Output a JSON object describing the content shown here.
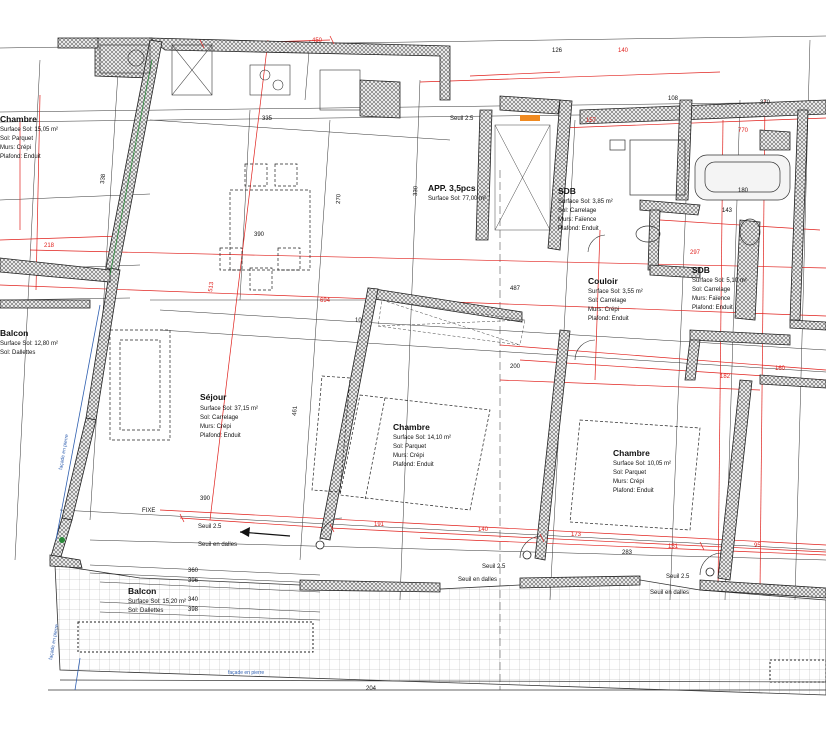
{
  "apartment": {
    "title": "APP. 3,5pcs",
    "surface": "Surface Sol: 77,00 m²"
  },
  "rooms": [
    {
      "id": "chambre-left",
      "title": "Chambre",
      "lines": [
        "Surface Sol: 15,05 m²",
        "Sol: Parquet",
        "Murs: Crépi",
        "Plafond: Enduit"
      ]
    },
    {
      "id": "balcon-left",
      "title": "Balcon",
      "lines": [
        "Surface Sol: 12,80 m²",
        "Sol: Dallettes"
      ]
    },
    {
      "id": "sejour",
      "title": "Séjour",
      "lines": [
        "Surface Sol: 37,15 m²",
        "Sol: Carrelage",
        "Murs: Crépi",
        "Plafond: Enduit"
      ]
    },
    {
      "id": "chambre-middle",
      "title": "Chambre",
      "lines": [
        "Surface Sol: 14,10 m²",
        "Sol: Parquet",
        "Murs: Crépi",
        "Plafond: Enduit"
      ]
    },
    {
      "id": "sdb-1",
      "title": "SDB",
      "lines": [
        "Surface Sol: 3,85 m²",
        "Sol: Carrelage",
        "Murs: Faïence",
        "Plafond: Enduit"
      ]
    },
    {
      "id": "couloir",
      "title": "Couloir",
      "lines": [
        "Surface Sol: 3,55 m²",
        "Sol: Carrelage",
        "Murs: Crépi",
        "Plafond: Enduit"
      ]
    },
    {
      "id": "sdb-2",
      "title": "SDB",
      "lines": [
        "Surface Sol: 5,10 m²",
        "Sol: Carrelage",
        "Murs: Faïence",
        "Plafond: Enduit"
      ]
    },
    {
      "id": "chambre-right",
      "title": "Chambre",
      "lines": [
        "Surface Sol: 10,05 m²",
        "Sol: Parquet",
        "Murs: Crépi",
        "Plafond: Enduit"
      ]
    },
    {
      "id": "balcon-bottom",
      "title": "Balcon",
      "lines": [
        "Surface Sol: 15,20 m²",
        "Sol: Dallettes"
      ]
    }
  ],
  "notes": {
    "seuil_1": "Seuil 2.5",
    "seuil_2": "Seuil 2.5",
    "seuil_3": "Seuil 2.5",
    "seuil_4": "Seuil 2.5",
    "seuil_dalles_1": "Seuil en dalles",
    "seuil_dalles_2": "Seuil en dalles",
    "seuil_dalles_3": "Seuil en dalles",
    "fixe": "FIXE",
    "facade_1": "façade en pierre",
    "facade_2": "façade en pierre",
    "facade_3": "façade en pierre"
  },
  "dims_red": [
    "450",
    "770",
    "218",
    "513",
    "694",
    "191",
    "140",
    "173",
    "95",
    "151",
    "160",
    "182",
    "297",
    "157",
    "140"
  ],
  "dims_black": [
    "126",
    "335",
    "390",
    "487",
    "330",
    "270",
    "461",
    "396",
    "360",
    "390",
    "283",
    "340",
    "398",
    "204",
    "338",
    "10",
    "200",
    "143",
    "108",
    "180",
    "370"
  ],
  "colors": {
    "wall_fill": "#d6d6d6",
    "wall_line": "#222222",
    "red": "#e0201c",
    "blue": "#2f5fb0",
    "orange": "#f08a20"
  }
}
